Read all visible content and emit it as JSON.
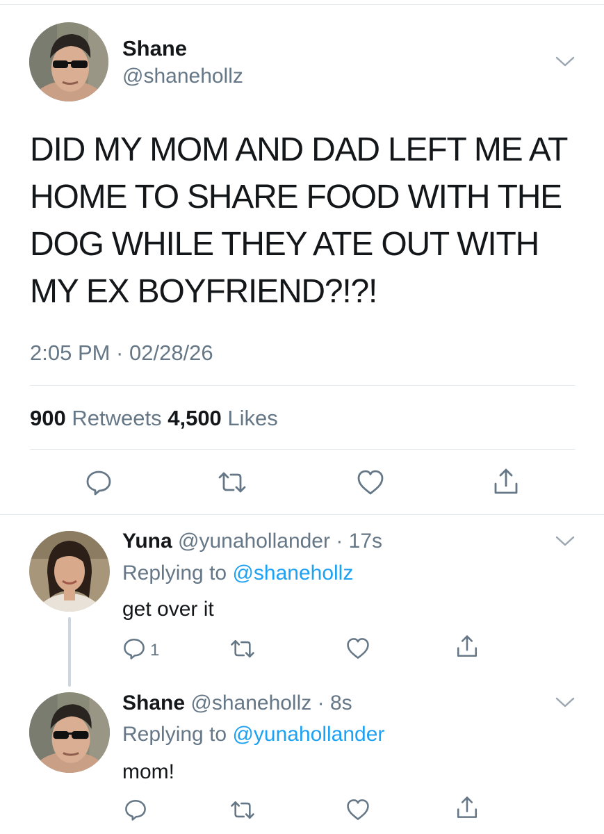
{
  "main_tweet": {
    "name": "Shane",
    "handle": "@shanehollz",
    "text": "DID MY MOM AND DAD LEFT ME AT HOME TO SHARE FOOD WITH THE DOG WHILE THEY ATE OUT WITH MY EX BOYFRIEND?!?!",
    "timestamp": "2:05 PM · 02/28/26",
    "retweets_count": "900",
    "retweets_label": "Retweets",
    "likes_count": "4,500",
    "likes_label": "Likes",
    "icons": [
      "chevron-down-icon",
      "reply-icon",
      "retweet-icon",
      "like-icon",
      "share-icon"
    ]
  },
  "replies": [
    {
      "name": "Yuna",
      "handle": "@yunahollander",
      "time": "· 17s",
      "replying_prefix": "Replying to",
      "replying_to": "@shanehollz",
      "text": "get over it",
      "reply_count": "1"
    },
    {
      "name": "Shane",
      "handle": "@shanehollz",
      "time": "· 8s",
      "replying_prefix": "Replying to",
      "replying_to": "@yunahollander",
      "text": "mom!",
      "reply_count": ""
    }
  ],
  "colors": {
    "text": "#14171a",
    "secondary": "#657786",
    "link": "#1da1f2",
    "divider": "#e1e8ed"
  }
}
